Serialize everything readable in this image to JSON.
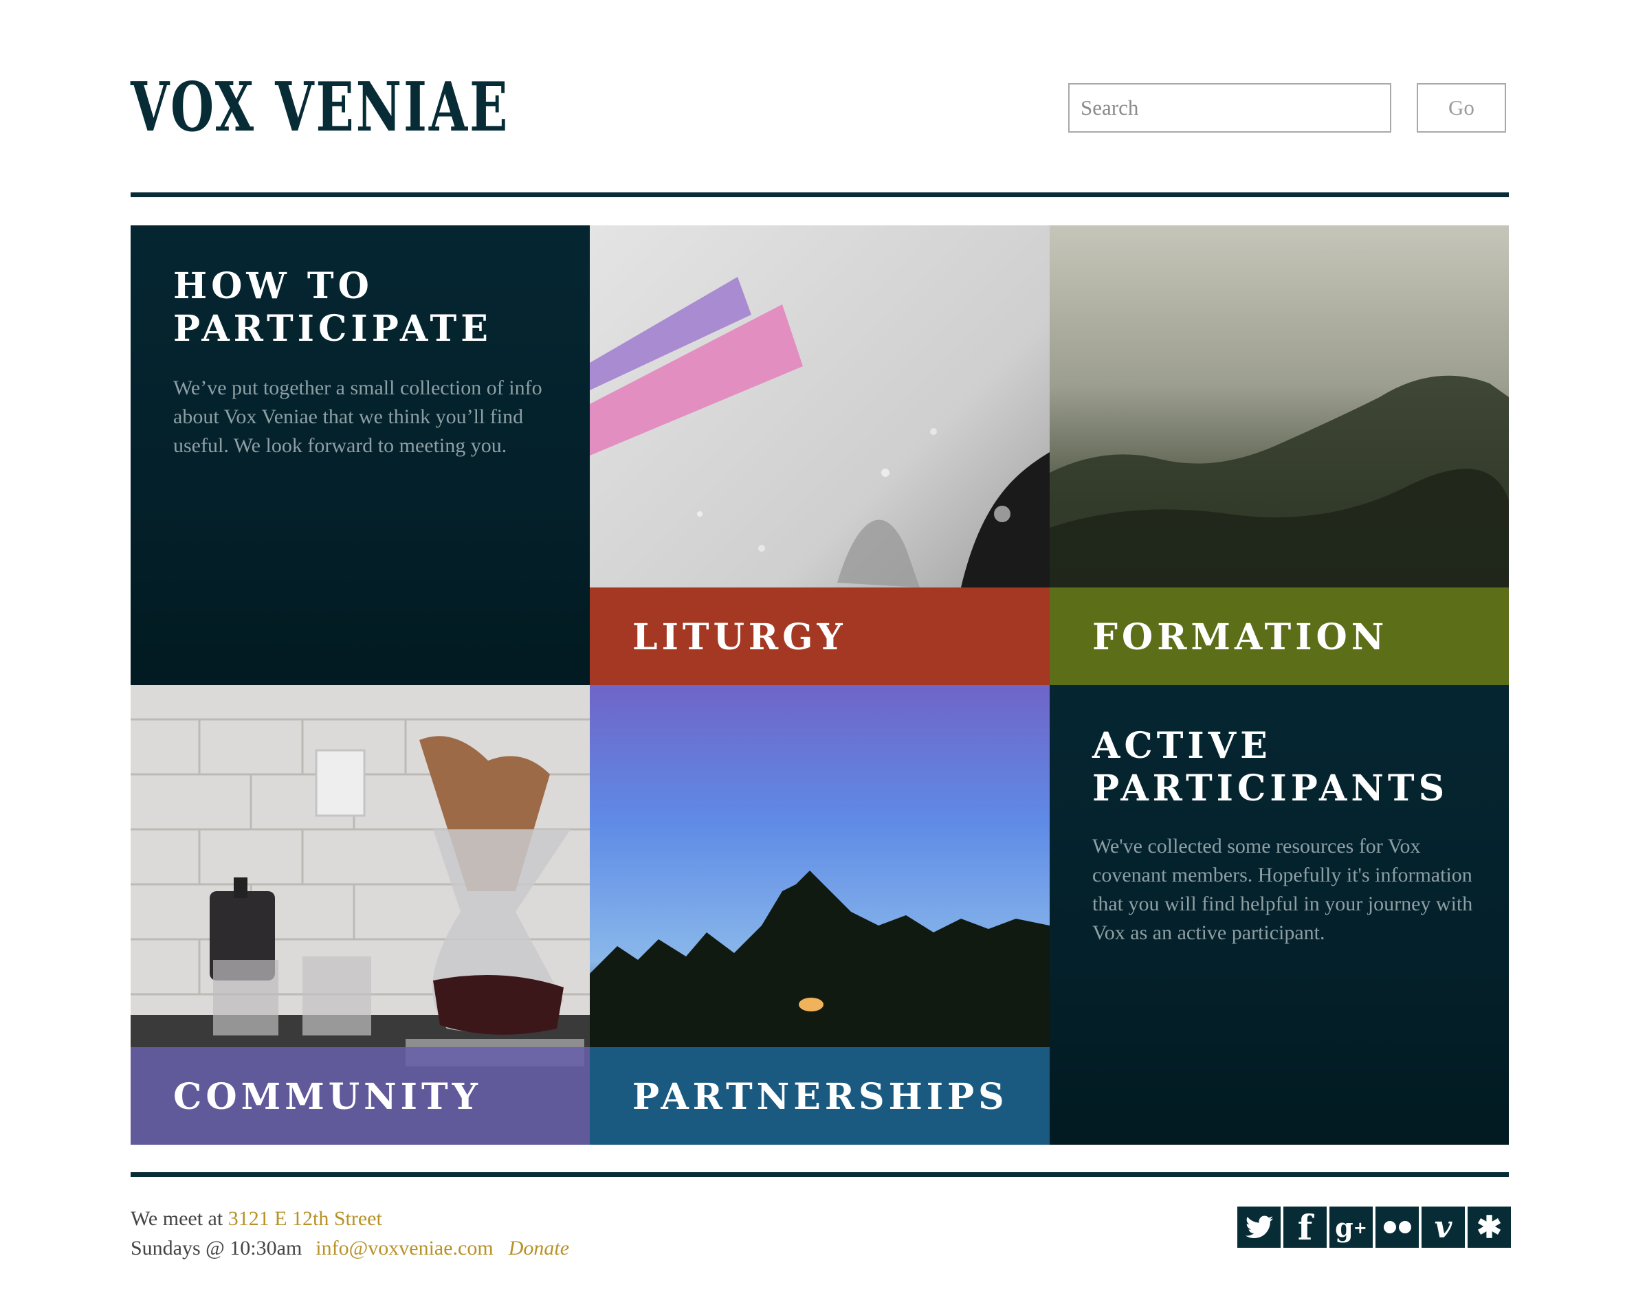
{
  "header": {
    "logo": "VOX VENIAE",
    "search_placeholder": "Search",
    "go_label": "Go"
  },
  "tiles": {
    "participate": {
      "title": "HOW TO\nPARTICIPATE",
      "body": "We’ve put together a small collection of info about Vox Veniae that we think you’ll find useful. We look forward to meeting you."
    },
    "liturgy": {
      "label": "LITURGY",
      "band_color": "#a63a24"
    },
    "formation": {
      "label": "FORMATION",
      "band_color": "#5d6d1a"
    },
    "community": {
      "label": "COMMUNITY",
      "band_color": "#665ea4"
    },
    "partnerships": {
      "label": "PARTNERSHIPS",
      "band_color": "#1a5a80"
    },
    "active": {
      "title": "ACTIVE\nPARTICIPANTS",
      "body": "We've collected some resources for Vox covenant members. Hopefully it's information that you will find helpful in your journey with Vox as an active participant."
    }
  },
  "footer": {
    "meet_prefix": "We meet at",
    "address": "3121 E 12th Street",
    "schedule": "Sundays @ 10:30am",
    "email": "info@voxveniae.com",
    "donate": "Donate",
    "social": [
      "twitter-icon",
      "facebook-icon",
      "google-plus-icon",
      "flickr-icon",
      "vimeo-icon",
      "yelp-icon"
    ]
  },
  "colors": {
    "brand_dark": "#072c36",
    "link_gold": "#b89228"
  }
}
